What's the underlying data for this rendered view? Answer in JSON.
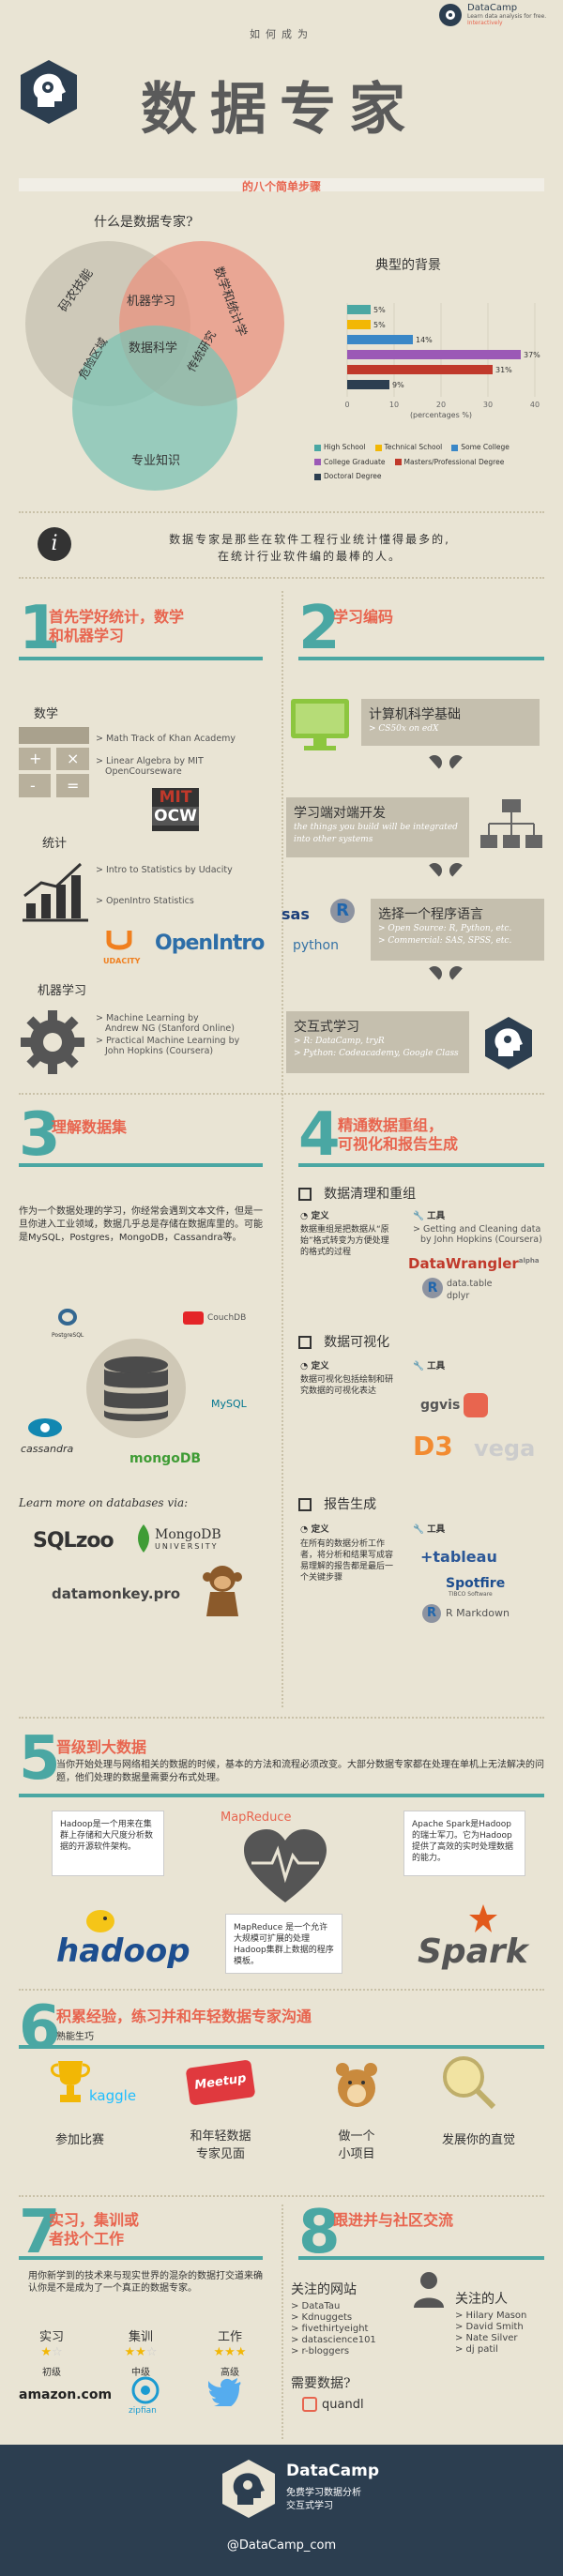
{
  "header": {
    "brand": "DataCamp",
    "tagline": "Learn data analysis for free.",
    "tagline2": "Interactively",
    "subtitle": "如何成为",
    "title": "数据专家",
    "banner": "的八个简单步骤"
  },
  "intro": {
    "venn_question": "什么是数据专家?",
    "venn_labels": [
      "码农技能",
      "数学和统计学",
      "机器学习",
      "数据科学",
      "危险区域",
      "传统研究",
      "专业知识"
    ],
    "bg_question": "典型的背景",
    "bars": {
      "xlabel": "(percentages %)",
      "xticks": [
        "0",
        "10",
        "20",
        "30",
        "40"
      ]
    },
    "legend": [
      "High School",
      "Technical School",
      "Some College",
      "College Graduate",
      "Masters/Professional Degree",
      "Doctoral Degree"
    ]
  },
  "chart_data": {
    "type": "bar",
    "orientation": "horizontal",
    "categories": [
      "High School",
      "Technical School",
      "Some College",
      "College Graduate",
      "Masters/Professional Degree",
      "Doctoral Degree"
    ],
    "values": [
      5,
      5,
      14,
      37,
      31,
      9
    ],
    "value_labels": [
      "5%",
      "5%",
      "14%",
      "37%",
      "31%",
      "9%"
    ],
    "colors": [
      "#4aa7a3",
      "#f2b705",
      "#3a87c7",
      "#9b59b6",
      "#c0392b",
      "#2c3e50"
    ],
    "title": "典型的背景",
    "xlabel": "(percentages %)",
    "xlim": [
      0,
      40
    ],
    "legend": "bottom"
  },
  "quote": {
    "line1": "数据专家是那些在软件工程行业统计懂得最多的,",
    "line2": "在统计行业软件编的最棒的人。"
  },
  "step1": {
    "num": "1",
    "title1": "首先学好统计，数学",
    "title2": "和机器学习",
    "math": {
      "title": "数学",
      "r1": "> Math Track of Khan Academy",
      "r2": "> Linear Algebra by MIT",
      "r2b": "OpenCourseware",
      "mit": "MIT",
      "ocw": "OCW"
    },
    "stats": {
      "title": "统计",
      "r1": "> Intro to Statistics by Udacity",
      "r2": "> OpenIntro Statistics",
      "udacity": "UDACITY",
      "openintro": "OpenIntro"
    },
    "ml": {
      "title": "机器学习",
      "r1": "> Machine Learning by",
      "r1b": "Andrew NG (Stanford Online)",
      "r2": "> Practical Machine Learning by",
      "r2b": "John Hopkins (Coursera)"
    }
  },
  "step2": {
    "num": "2",
    "title": "学习编码",
    "cs": {
      "t": "计算机科学基础",
      "s": "> CS50x on edX"
    },
    "dev": {
      "t": "学习端对端开发",
      "s1": "the things you build will be integrated",
      "s2": "into other systems"
    },
    "lang": {
      "t": "选择一个程序语言",
      "s1": "> Open Source: R, Python, etc.",
      "s2": "> Commercial: SAS, SPSS, etc."
    },
    "interactive": {
      "t": "交互式学习",
      "s1": "> R: DataCamp, tryR",
      "s2": "> Python: Codeacademy, Google Class"
    },
    "sas": "sas",
    "r": "R",
    "python": "python"
  },
  "step3": {
    "num": "3",
    "title": "理解数据集",
    "text": "作为一个数据处理的学习，你经常会遇到文本文件，但是一旦你进入工业领域，数据几乎总是存储在数据库里的。可能是MySQL，Postgres，MongoDB，Cassandra等。",
    "postgres": "PostgreSQL",
    "couch": "CouchDB",
    "mysql": "MySQL",
    "cassandra": "cassandra",
    "mongo": "mongoDB",
    "learn_more": "Learn more on databases via:",
    "sqlzoo": "SQLzoo",
    "mongou": "MongoDB",
    "mongou2": "UNIVERSITY",
    "datamonkey": "datamonkey.pro"
  },
  "step4": {
    "num": "4",
    "title1": "精通数据重组，",
    "title2": "可视化和报告生成",
    "wrangling": {
      "h": "数据清理和重组",
      "def_label": "定义",
      "def": "数据重组是把数据从“原始”格式转变为方便处理的格式的过程",
      "tool_label": "工具",
      "t1": "> Getting and Cleaning data",
      "t1b": "by John Hopkins (Coursera)",
      "dw": "DataWrangler",
      "alpha": "alpha",
      "t2": "data.table",
      "t3": "dplyr"
    },
    "viz": {
      "h": "数据可视化",
      "def_label": "定义",
      "def": "数据可视化包括绘制和研究数据的可视化表达",
      "tool_label": "工具",
      "ggvis": "ggvis",
      "d3": "D3",
      "vega": "vega"
    },
    "report": {
      "h": "报告生成",
      "def_label": "定义",
      "def": "在所有的数据分析工作者，将分析和结果写成容易理解的报告都是最后一个关键步骤",
      "tool_label": "工具",
      "tableau": "+tableau",
      "spotfire": "Spotfire",
      "spotfire_sub": "TIBCO Software",
      "rmd": "R Markdown"
    }
  },
  "step5": {
    "num": "5",
    "title": "晋级到大数据",
    "text": "当你开始处理与网络相关的数据的时候，基本的方法和流程必须改变。大部分数据专家都在处理在单机上无法解决的问题，他们处理的数据量需要分布式处理。",
    "hadoop_box": "Hadoop是一个用来在集群上存储和大尺度分析数据的开源软件架构。",
    "mapreduce": "MapReduce",
    "mapreduce_box": "MapReduce 是一个允许大规模可扩展的处理Hadoop集群上数据的程序模板。",
    "spark_box": "Apache Spark是Hadoop的瑞士军刀。它为Hadoop提供了高效的实时处理数据的能力。",
    "hadoop": "hadoop",
    "spark": "Spark"
  },
  "step6": {
    "num": "6",
    "title": "积累经验，练习并和年轻数据专家沟通",
    "sub": "熟能生巧",
    "items": [
      "参加比赛",
      "和年轻数据",
      "专家见面",
      "做一个",
      "小项目",
      "发展你的直觉"
    ],
    "kaggle": "kaggle",
    "meetup": "Meetup"
  },
  "step7": {
    "num": "7",
    "title1": "实习，集训或",
    "title2": "者找个工作",
    "text": "用你新学到的技术来与现实世界的混杂的数据打交道来确认你是不是成为了一个真正的数据专家。",
    "cols": [
      "实习",
      "集训",
      "工作"
    ],
    "levels": [
      "初级",
      "中级",
      "高级"
    ],
    "amazon": "amazon.com",
    "zipfian": "zipfian"
  },
  "step8": {
    "num": "8",
    "title": "跟进并与社区交流",
    "sites_h": "关注的网站",
    "sites": [
      "> DataTau",
      "> Kdnuggets",
      "> fivethirtyeight",
      "> datascience101",
      "> r-bloggers"
    ],
    "people_h": "关注的人",
    "people": [
      "> Hilary Mason",
      "> David Smith",
      "> Nate Silver",
      "> dj patil"
    ],
    "data_h": "需要数据?",
    "quandl": "quandl"
  },
  "footer": {
    "brand": "DataCamp",
    "l1": "免费学习数据分析",
    "l2": "交互式学习",
    "handle": "@DataCamp_com"
  }
}
